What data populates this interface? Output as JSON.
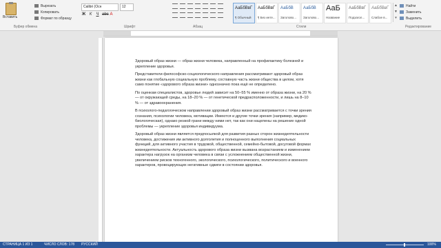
{
  "clipboard": {
    "paste_label": "Вставить",
    "cut_label": "Вырезать",
    "copy_label": "Копировать",
    "format_painter_label": "Формат по образцу",
    "group_label": "Буфер обмена"
  },
  "font": {
    "font_name": "Calibri (Осн",
    "font_size": "12",
    "group_label": "Шрифт"
  },
  "paragraph": {
    "group_label": "Абзац"
  },
  "styles": {
    "group_label": "Стили",
    "items": [
      {
        "sample": "АаБбВвГ",
        "name": "¶ Обычный"
      },
      {
        "sample": "АаБбВвГ",
        "name": "¶ Без инте..."
      },
      {
        "sample": "АаБбВ",
        "name": "Заголово..."
      },
      {
        "sample": "АаБбВ",
        "name": "Заголово..."
      },
      {
        "sample": "АаБ",
        "name": "Название"
      },
      {
        "sample": "АаБбВвГ",
        "name": "Подзагол..."
      },
      {
        "sample": "АаБбВвГ",
        "name": "Слабое в..."
      }
    ]
  },
  "editing": {
    "find_label": "Найти",
    "replace_label": "Заменить",
    "select_label": "Выделить",
    "group_label": "Редактирование"
  },
  "document": {
    "paragraphs": [
      "Здоровый образ жизни — образ жизни человека, направленный на профилактику болезней и укрепление здоровья.",
      "Представители философско-социологического направления рассматривают здоровый образ жизни как глобальную социальную проблему, составную часть жизни общества в целом, хотя само понятие «здорового образа жизни» однозначно пока ещё не определено.",
      "По оценкам специалистов, здоровье людей зависит на 50–55 % именно от образа жизни, на 20 % — от окружающей среды, на 18–20 % — от генетической предрасположенности, и лишь на 8–10 % — от здравоохранения.",
      "В психолого-педагогическом направлении здоровый образ жизни рассматривается с точки зрения сознания, психологии человека, мотивации. Имеются и другие точки зрения (например, медико-биологическая), однако резкой грани между ними нет, так как они нацелены на решение одной проблемы — укрепление здоровья индивидуума.",
      "Здоровый образ жизни является предпосылкой для развития разных сторон жизнедеятельности человека, достижения им активного долголетия и полноценного выполнения социальных функций, для активного участия в трудовой, общественной, семейно-бытовой, досуговой формах жизнедеятельности. Актуальность здорового образа жизни вызвана возрастанием и изменением характера нагрузок на организм человека в связи с усложнением общественной жизни, увеличением рисков техногенного, экологического, психологического, политического и военного характеров, провоцирующих негативные сдвиги в состоянии здоровья."
    ]
  },
  "status": {
    "page": "СТРАНИЦА 1 ИЗ 1",
    "words": "ЧИСЛО СЛОВ: 178",
    "language": "РУССКИЙ",
    "zoom": "100%"
  },
  "colors": {
    "status_bar": "#2b579a",
    "ribbon": "#f3f3f3"
  }
}
